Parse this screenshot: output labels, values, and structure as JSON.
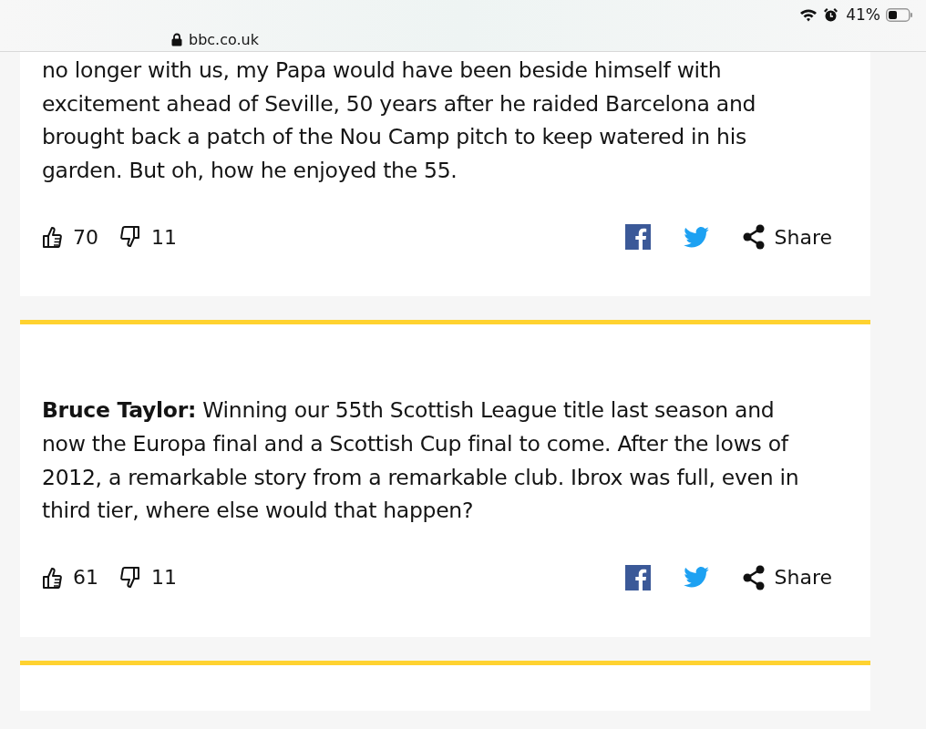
{
  "status_bar": {
    "battery_text": "41%"
  },
  "address_bar": {
    "url": "bbc.co.uk"
  },
  "comments": [
    {
      "text": "no longer with us, my Papa would have been beside himself with excitement ahead of Seville, 50 years after he raided Barcelona and brought back a patch of the Nou Camp pitch to keep watered in his garden. But oh, how he enjoyed the 55.",
      "likes": "70",
      "dislikes": "11",
      "share_label": "Share",
      "cut_top": true
    },
    {
      "text": "**Bruce Taylor:** Winning our 55th Scottish League title last season and now the Europa final and a Scottish Cup final to come. After the lows of 2012, a remarkable story from a remarkable club. Ibrox was full, even in third tier, where else would that happen?",
      "likes": "61",
      "dislikes": "11",
      "share_label": "Share",
      "cut_top": false
    }
  ]
}
